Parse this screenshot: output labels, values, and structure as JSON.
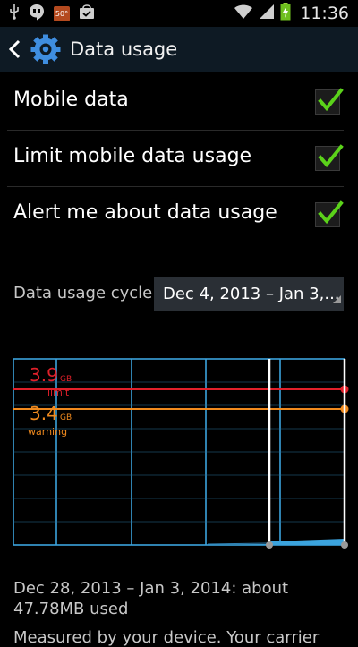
{
  "status_bar": {
    "time": "11:36",
    "temperature_badge": "50°",
    "icons": [
      "usb-icon",
      "hangouts-icon",
      "weather-icon",
      "shopping-bag-icon",
      "wifi-icon",
      "signal-icon",
      "battery-charging-icon"
    ]
  },
  "action_bar": {
    "title": "Data usage",
    "icons": [
      "back-icon",
      "settings-gear-icon"
    ]
  },
  "settings": [
    {
      "label": "Mobile data",
      "checked": true
    },
    {
      "label": "Limit mobile data usage",
      "checked": true
    },
    {
      "label": "Alert me about data usage",
      "checked": true
    }
  ],
  "cycle": {
    "label": "Data usage cycle",
    "value": "Dec 4, 2013 – Jan 3,..."
  },
  "chart_data": {
    "type": "area",
    "limit": {
      "value": "3.9",
      "unit": "GB",
      "label": "limit",
      "color": "#e0202a"
    },
    "warning": {
      "value": "3.4",
      "unit": "GB",
      "label": "warning",
      "color": "#f08a1e"
    },
    "grid_color": "#3ba3dd",
    "usage_color": "#3ba3dd"
  },
  "usage": {
    "text": "Dec 28, 2013 – Jan 3, 2014: about 47.78MB used",
    "cut_off_text": "Measured by your device. Your carrier"
  }
}
